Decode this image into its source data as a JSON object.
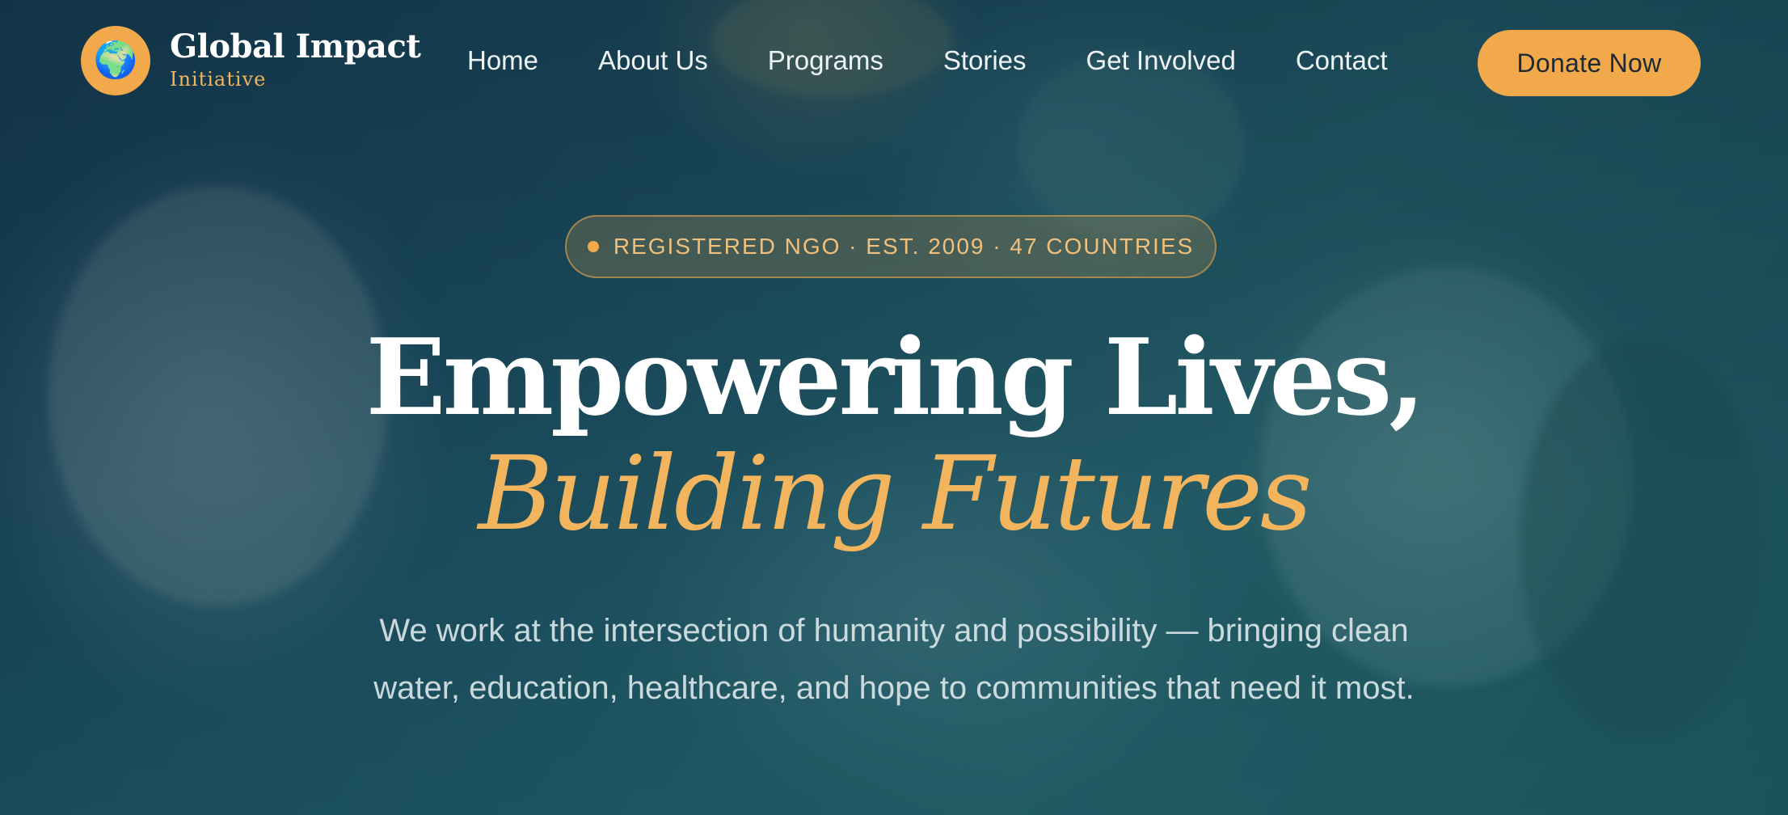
{
  "brand": {
    "name": "Global Impact",
    "tagline": "Initiative",
    "logo_icon": "globe-emoji",
    "logo_glyph": "🌍",
    "logo_bg_color": "#f2a94c"
  },
  "nav": {
    "items": [
      {
        "label": "Home"
      },
      {
        "label": "About Us"
      },
      {
        "label": "Programs"
      },
      {
        "label": "Stories"
      },
      {
        "label": "Get Involved"
      },
      {
        "label": "Contact"
      }
    ],
    "cta_label": "Donate Now"
  },
  "hero": {
    "badge_text": "REGISTERED NGO · EST. 2009 · 47 COUNTRIES",
    "headline_line1": "Empowering Lives,",
    "headline_line2": "Building Futures",
    "description": "We work at the intersection of humanity and possibility — bringing clean water, education, healthcare, and hope to communities that need it most.",
    "background_image": "children-smiling-photo"
  },
  "colors": {
    "accent": "#f2a94c",
    "overlay": "#123a4a",
    "text": "#ffffff"
  }
}
